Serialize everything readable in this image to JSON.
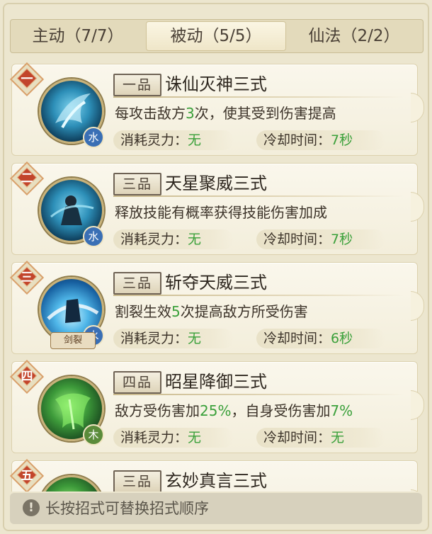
{
  "tabs": [
    {
      "label": "主动（7/7）",
      "active": false
    },
    {
      "label": "被动（5/5）",
      "active": true
    },
    {
      "label": "仙法（2/2）",
      "active": false
    }
  ],
  "skills": [
    {
      "rank": "一",
      "grade": "一品",
      "name": "诛仙灭神三式",
      "desc_pre": "每攻击敌方",
      "desc_hl": "3",
      "desc_post": "次，使其受到伤害提高",
      "desc_hl2": "",
      "element": "水",
      "tag": "",
      "mp_label": "消耗灵力：",
      "mp_value": "无",
      "cd_label": "冷却时间：",
      "cd_value": "7秒"
    },
    {
      "rank": "二",
      "grade": "三品",
      "name": "天星聚威三式",
      "desc_pre": "释放技能有概率获得技能伤害加成",
      "desc_hl": "",
      "desc_post": "",
      "desc_hl2": "",
      "element": "水",
      "tag": "",
      "mp_label": "消耗灵力：",
      "mp_value": "无",
      "cd_label": "冷却时间：",
      "cd_value": "7秒"
    },
    {
      "rank": "三",
      "grade": "三品",
      "name": "斩夺天威三式",
      "desc_pre": "割裂生效",
      "desc_hl": "5",
      "desc_post": "次提高敌方所受伤害",
      "desc_hl2": "",
      "element": "水",
      "tag": "剑裂",
      "mp_label": "消耗灵力：",
      "mp_value": "无",
      "cd_label": "冷却时间：",
      "cd_value": "6秒"
    },
    {
      "rank": "四",
      "grade": "四品",
      "name": "昭星降御三式",
      "desc_pre": "敌方受伤害加",
      "desc_hl": "25%",
      "desc_post": "，自身受伤害加",
      "desc_hl2": "7%",
      "element": "木",
      "tag": "",
      "mp_label": "消耗灵力：",
      "mp_value": "无",
      "cd_label": "冷却时间：",
      "cd_value": "无"
    },
    {
      "rank": "五",
      "grade": "三品",
      "name": "玄妙真言三式",
      "desc_pre": "",
      "desc_hl": "",
      "desc_post": "",
      "desc_hl2": "",
      "element": "",
      "tag": "",
      "mp_label": "",
      "mp_value": "",
      "cd_label": "",
      "cd_value": ""
    }
  ],
  "footer": {
    "icon": "exclamation-icon",
    "text": "长按招式可替换招式顺序"
  },
  "colors": {
    "highlight": "#3aa03a",
    "rank_badge": "#c2452c",
    "water": "#3a6fb5",
    "wood": "#5a8b3a"
  }
}
